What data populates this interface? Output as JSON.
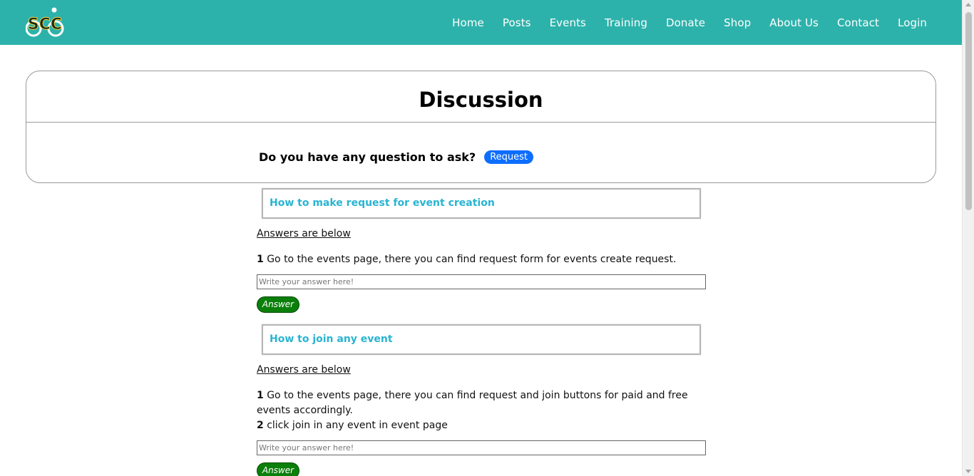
{
  "nav": {
    "logo_text": "SCC",
    "links": [
      "Home",
      "Posts",
      "Events",
      "Training",
      "Donate",
      "Shop",
      "About Us",
      "Contact",
      "Login"
    ]
  },
  "discussion": {
    "title": "Discussion",
    "ask_prompt": "Do you have any question to ask?",
    "request_label": "Request"
  },
  "questions": [
    {
      "title": "How to make request for event creation",
      "answers_label": "Answers are below",
      "answers": [
        {
          "num": "1",
          "text": "Go to the events page, there you can find request form for events create request."
        }
      ],
      "input_placeholder": "Write your answer here!",
      "answer_button": "Answer"
    },
    {
      "title": "How to join any event",
      "answers_label": "Answers are below",
      "answers": [
        {
          "num": "1",
          "text": "Go to the events page, there you can find request and join buttons for paid and free events accordingly."
        },
        {
          "num": "2",
          "text": "click join in any event in event page"
        }
      ],
      "input_placeholder": "Write your answer here!",
      "answer_button": "Answer"
    }
  ],
  "colors": {
    "navbar": "#2db2ab",
    "question_title": "#29b4d2",
    "request_button": "#0d6efd",
    "answer_button": "#0a7f0a"
  }
}
